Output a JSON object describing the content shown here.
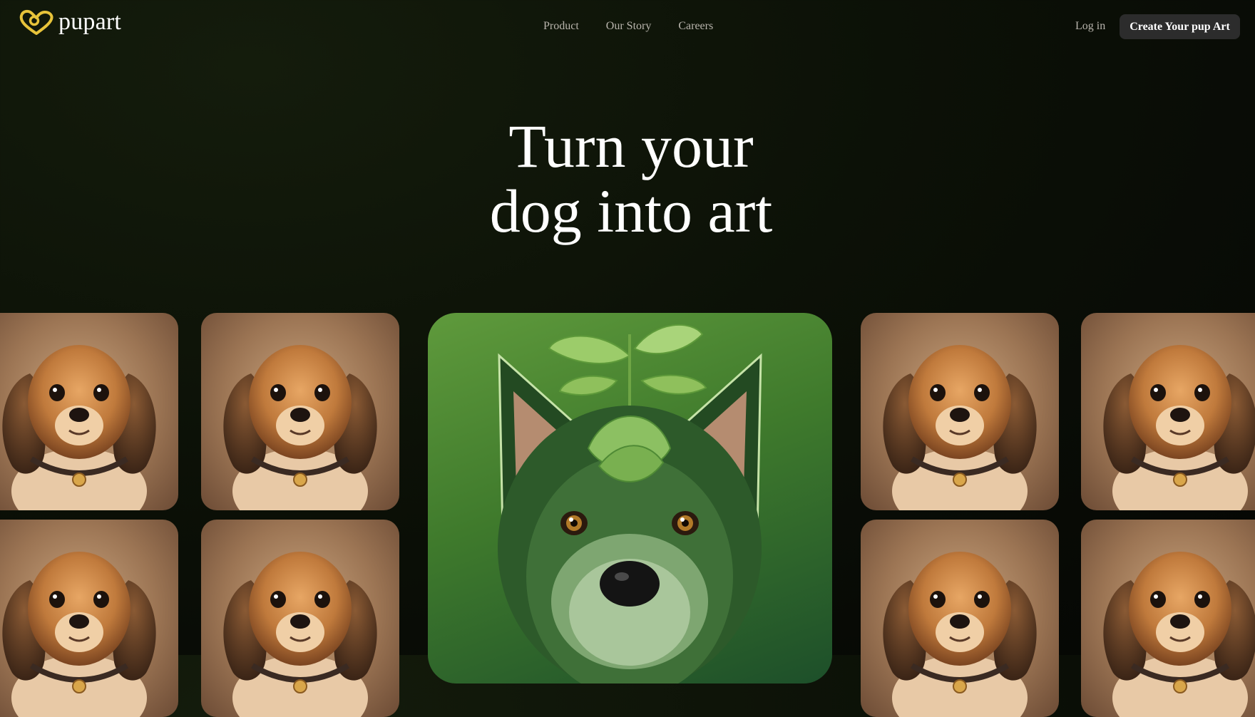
{
  "brand": {
    "name": "pupart",
    "logo_icon": "heart-pup-icon",
    "accent": "#e7c33a"
  },
  "nav": {
    "links": [
      "Product",
      "Our Story",
      "Careers"
    ],
    "login": "Log in",
    "cta": "Create Your pup Art"
  },
  "hero": {
    "title_line1": "Turn your",
    "title_line2": "dog into art"
  },
  "gallery": {
    "tile_image": "puppy-portrait",
    "feature_image": "green-leaf-dog-portrait"
  },
  "colors": {
    "background": "#0c1107",
    "button_bg": "#2c2c2c",
    "feature_green": "#3f7a2c"
  }
}
